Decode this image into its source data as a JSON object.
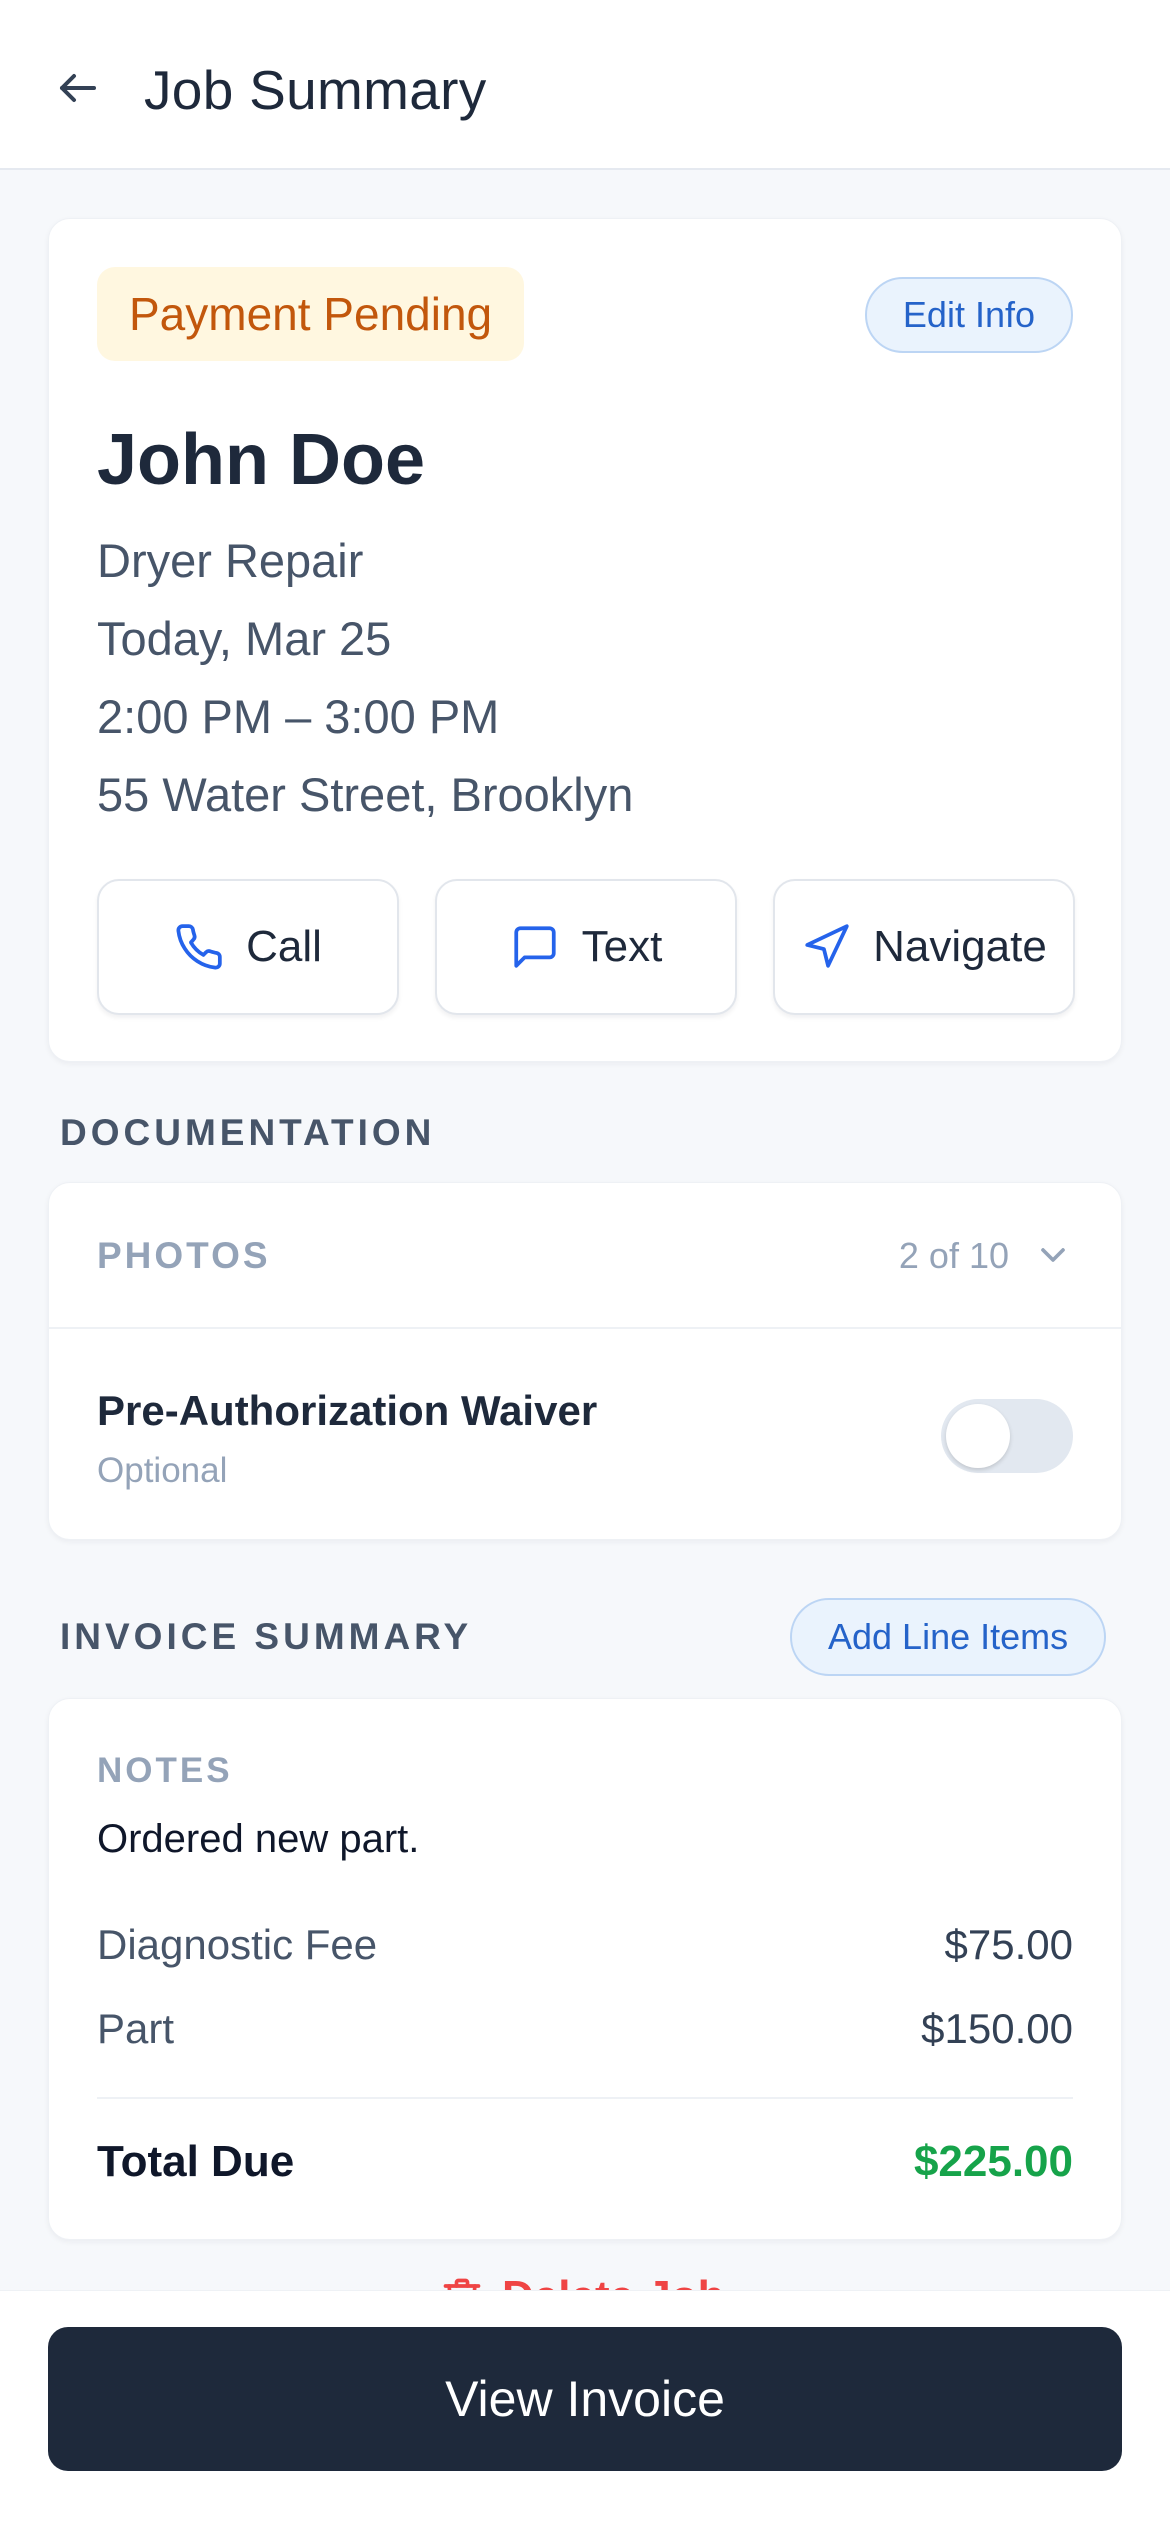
{
  "header": {
    "title": "Job Summary",
    "back_icon": "arrow-left-icon"
  },
  "customer": {
    "status": "Payment Pending",
    "edit_label": "Edit Info",
    "name": "John Doe",
    "service": "Dryer Repair",
    "date": "Today, Mar 25",
    "time": "2:00 PM – 3:00 PM",
    "address": "55 Water Street, Brooklyn",
    "actions": [
      {
        "label": "Call",
        "icon": "phone-icon"
      },
      {
        "label": "Text",
        "icon": "message-icon"
      },
      {
        "label": "Navigate",
        "icon": "navigation-icon"
      }
    ]
  },
  "documentation": {
    "section_label": "DOCUMENTATION",
    "photos_label": "PHOTOS",
    "photos_count": "2 of 10",
    "waiver_title": "Pre-Authorization Waiver",
    "waiver_sub": "Optional",
    "waiver_enabled": false
  },
  "invoice": {
    "section_label": "INVOICE SUMMARY",
    "add_label": "Add Line Items",
    "notes_label": "NOTES",
    "notes_text": "Ordered new part.",
    "lines": [
      {
        "label": "Diagnostic Fee",
        "value": "$75.00"
      },
      {
        "label": "Part",
        "value": "$150.00"
      }
    ],
    "total_label": "Total Due",
    "total_value": "$225.00"
  },
  "delete_label": "Delete Job",
  "footer": {
    "button_label": "View Invoice"
  },
  "colors": {
    "accent": "#2563c9",
    "status": "#c2570c",
    "total": "#16a34a",
    "danger": "#ef4444",
    "primary_button": "#1e293b"
  }
}
